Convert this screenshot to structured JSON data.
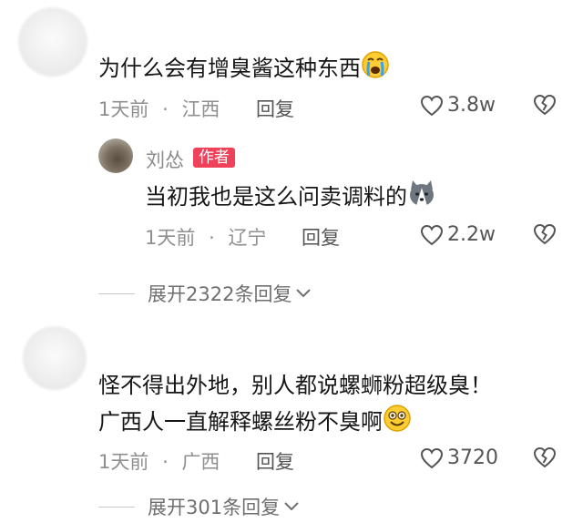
{
  "comments": [
    {
      "text": "为什么会有增臭酱这种东西",
      "emoji": "crying-face-icon",
      "time": "1天前",
      "location": "江西",
      "reply_label": "回复",
      "likes": "3.8w"
    },
    {
      "text_line1": "怪不得出外地，别人都说螺蛳粉超级臭！",
      "text_line2": "广西人一直解释螺丝粉不臭啊",
      "emoji": "grinning-face-icon",
      "time": "1天前",
      "location": "广西",
      "reply_label": "回复",
      "likes": "3720"
    }
  ],
  "reply": {
    "username": "刘怂",
    "badge": "作者",
    "text": "当初我也是这么问卖调料的",
    "emoji": "husky-dog-icon",
    "time": "1天前",
    "location": "辽宁",
    "reply_label": "回复",
    "likes": "2.2w"
  },
  "expand": [
    {
      "label": "展开2322条回复"
    },
    {
      "label": "展开301条回复"
    }
  ],
  "separator": "·",
  "colors": {
    "badge": "#f0415b",
    "meta": "#8f8f8f",
    "text": "#161616"
  }
}
